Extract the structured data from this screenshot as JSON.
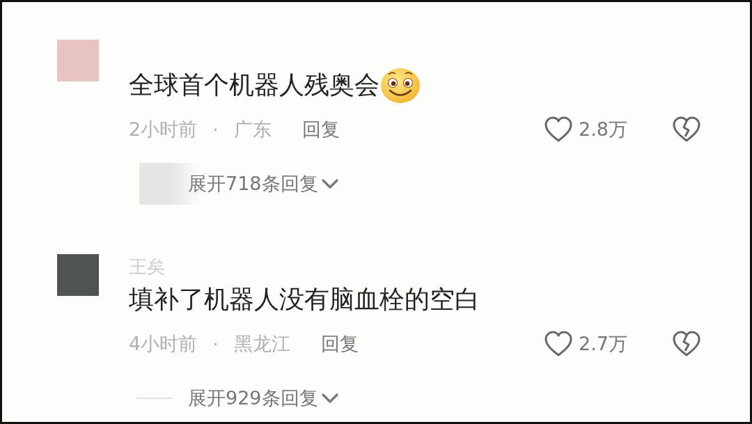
{
  "comments": [
    {
      "color": "#e6c5c1",
      "text": "全球首个机器人残奥会",
      "has_emoji": true,
      "time": "2小时前",
      "separator": "·",
      "location": "广东",
      "reply": "回复",
      "likes": "2.8万",
      "kind": "blur",
      "expand": "展开718条回复"
    },
    {
      "color": "#4e5353",
      "username": "王矣",
      "text": "填补了机器人没有脑血栓的空白",
      "has_emoji": false,
      "time": "4小时前",
      "separator": "·",
      "location": "黑龙江",
      "reply": "回复",
      "likes": "2.7万",
      "kind": "line",
      "expand": "展开929条回复"
    }
  ]
}
